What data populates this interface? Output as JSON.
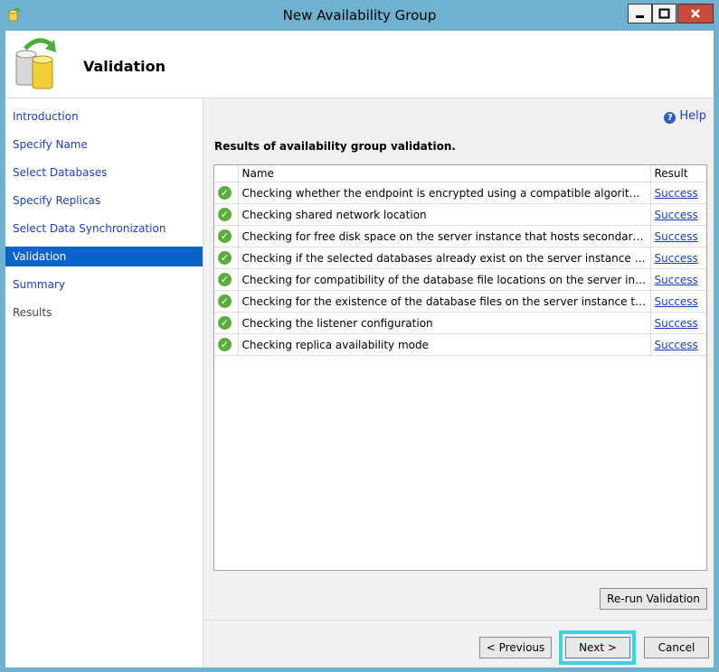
{
  "window": {
    "title": "New Availability Group",
    "colors": {
      "frame": "#6fb1cf",
      "close": "#c74a3b",
      "accent": "#0a64c8"
    }
  },
  "header": {
    "title": "Validation"
  },
  "nav": {
    "items": [
      {
        "label": "Introduction",
        "state": "link"
      },
      {
        "label": "Specify Name",
        "state": "link"
      },
      {
        "label": "Select Databases",
        "state": "link"
      },
      {
        "label": "Specify Replicas",
        "state": "link"
      },
      {
        "label": "Select Data Synchronization",
        "state": "link"
      },
      {
        "label": "Validation",
        "state": "active"
      },
      {
        "label": "Summary",
        "state": "link"
      },
      {
        "label": "Results",
        "state": "disabled"
      }
    ]
  },
  "main": {
    "help_label": "Help",
    "results_heading": "Results of availability group validation.",
    "table": {
      "columns": [
        "Name",
        "Result"
      ],
      "rows": [
        {
          "name": "Checking whether the endpoint is encrypted using a compatible algorithm",
          "result": "Success"
        },
        {
          "name": "Checking shared network location",
          "result": "Success"
        },
        {
          "name": "Checking for free disk space on the server instance that hosts secondary re...",
          "result": "Success"
        },
        {
          "name": "Checking if the selected databases already exist on the server instance that ...",
          "result": "Success"
        },
        {
          "name": "Checking for compatibility of the database file locations on the server insta...",
          "result": "Success"
        },
        {
          "name": "Checking for the existence of the database files on the server instance that ...",
          "result": "Success"
        },
        {
          "name": "Checking the listener configuration",
          "result": "Success"
        },
        {
          "name": "Checking replica availability mode",
          "result": "Success"
        }
      ]
    },
    "rerun_label": "Re-run Validation"
  },
  "footer": {
    "previous_label": "< Previous",
    "next_label": "Next >",
    "cancel_label": "Cancel"
  },
  "icons": {
    "app": "availability-group-icon",
    "header": "database-sync-icon",
    "help": "help-icon",
    "row_status": "success-check-icon"
  }
}
